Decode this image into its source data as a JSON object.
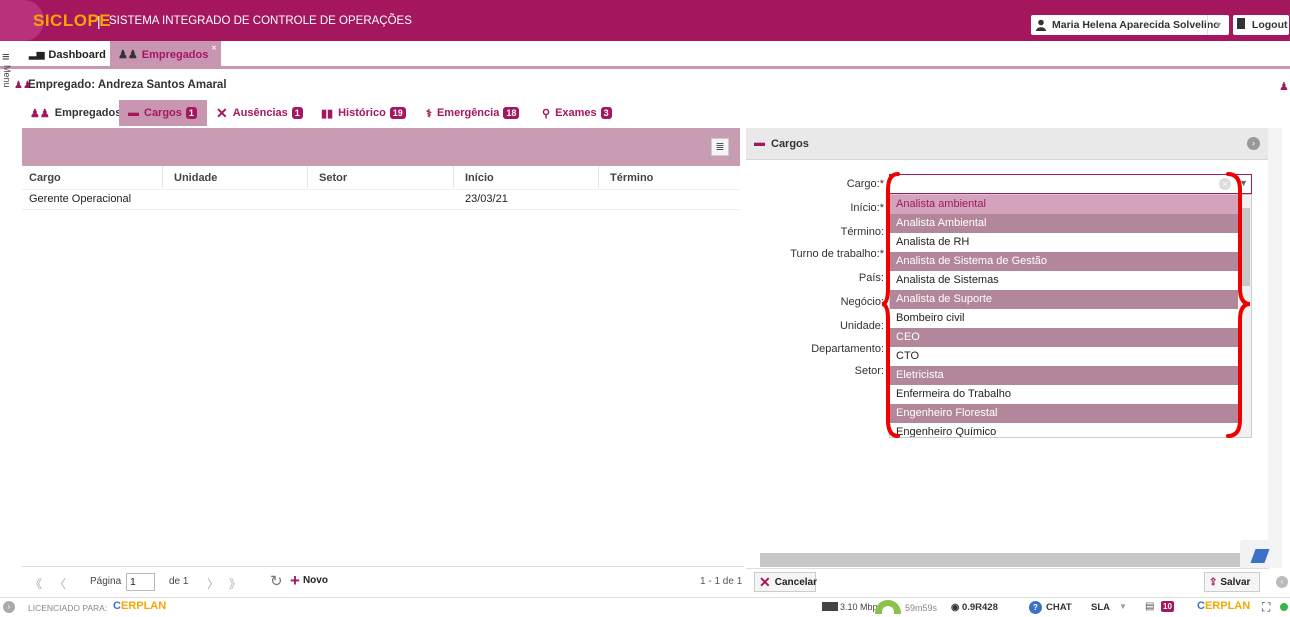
{
  "header": {
    "logo": "SICLOPE",
    "separator": "|",
    "app_name": "SISTEMA INTEGRADO DE CONTROLE DE OPERAÇÕES",
    "user_name": "Maria Helena Aparecida Solvelino",
    "logout_label": "Logout",
    "brand_color": "#a4175f",
    "accent_color": "#f7a600"
  },
  "sidebar": {
    "menu_label": "Menu",
    "icon": "hamburger-icon"
  },
  "tabs": [
    {
      "label": "Dashboard",
      "icon": "bar-chart-icon"
    },
    {
      "label": "Empregados",
      "icon": "people-icon",
      "close": "×"
    }
  ],
  "employee": {
    "title": "Empregado: Andreza Santos Amaral"
  },
  "subtabs": [
    {
      "label": "Empregados",
      "badge": ""
    },
    {
      "label": "Cargos",
      "badge": "1"
    },
    {
      "label": "Ausências",
      "badge": "1"
    },
    {
      "label": "Histórico",
      "badge": "19"
    },
    {
      "label": "Emergência",
      "badge": "18"
    },
    {
      "label": "Exames",
      "badge": "3"
    }
  ],
  "grid": {
    "columns": [
      "Cargo",
      "Unidade",
      "Setor",
      "Início",
      "Término"
    ],
    "rows": [
      {
        "cargo": "Gerente Operacional",
        "unidade": "",
        "setor": "",
        "inicio": "23/03/21",
        "termino": ""
      }
    ]
  },
  "pager": {
    "page_label": "Página",
    "page_value": "1",
    "of_label": "de 1",
    "new_label": "Novo",
    "count": "1 - 1 de 1"
  },
  "panel": {
    "title": "Cargos",
    "fields": {
      "cargo": "Cargo:*",
      "inicio": "Início:*",
      "termino": "Término:",
      "turno": "Turno de trabalho:*",
      "pais": "País:",
      "negocio": "Negócio:",
      "unidade": "Unidade:",
      "departamento": "Departamento:",
      "setor": "Setor:"
    },
    "cargo_value": "",
    "options": [
      "Analista ambiental",
      "Analista Ambiental",
      "Analista de RH",
      "Analista de Sistema de Gestão",
      "Analista de Sistemas",
      "Analista de Suporte",
      "Bombeiro civil",
      "CEO",
      "CTO",
      "Eletricista",
      "Enfermeira do Trabalho",
      "Engenheiro Florestal",
      "Engenheiro Químico"
    ],
    "cancel_label": "Cancelar",
    "save_label": "Salvar"
  },
  "status": {
    "licensed_label": "LICENCIADO PARA:",
    "erplan": "ERPLAN",
    "speed": "3.10 Mbps",
    "session": "59m59s",
    "version": "0.9R428",
    "chat": "CHAT",
    "sla": "SLA",
    "messages": "10"
  }
}
